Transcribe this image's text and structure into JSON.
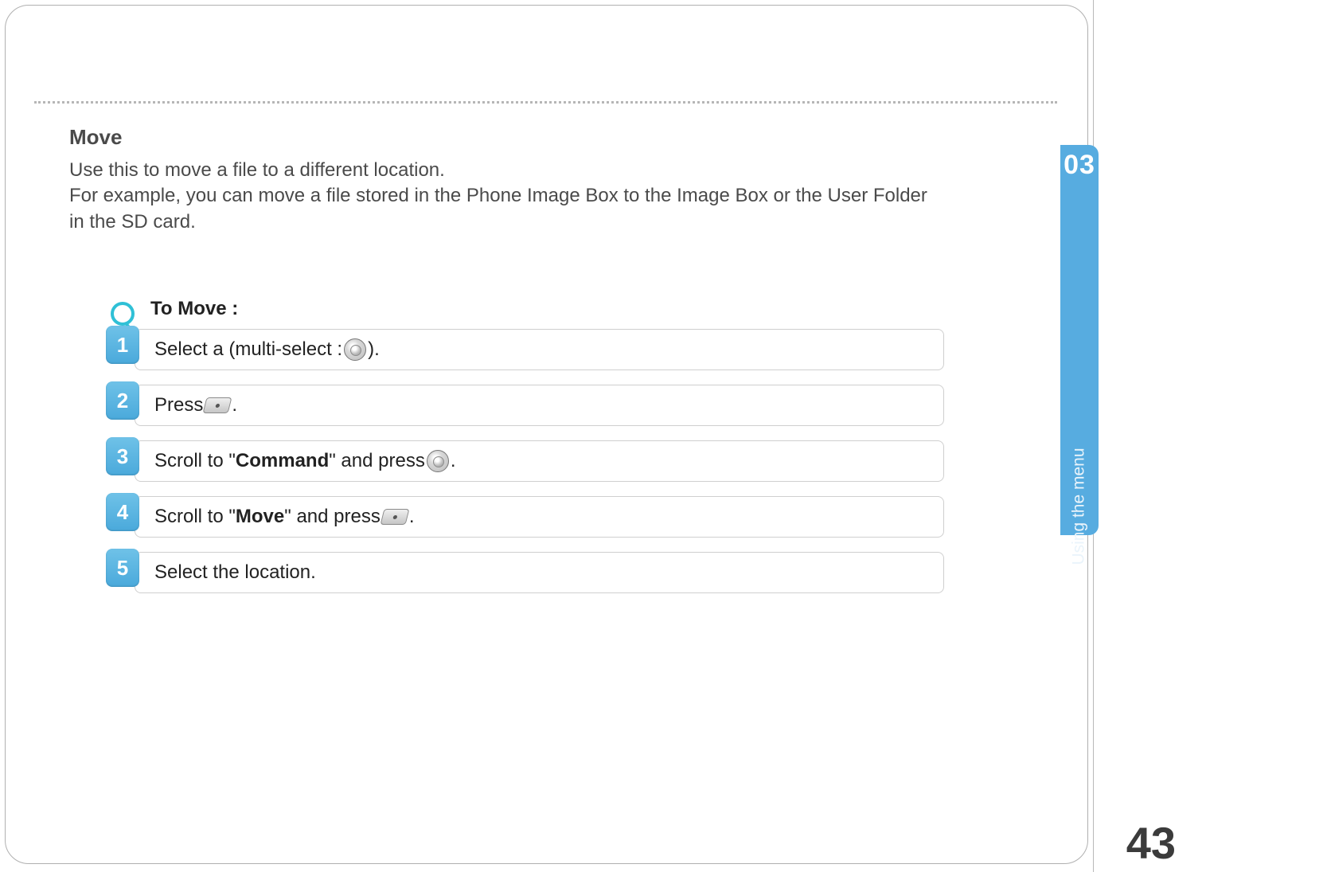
{
  "chapter": {
    "number": "03",
    "label": "Using the menu"
  },
  "page_number": "43",
  "section": {
    "title": "Move",
    "description_line1": "Use this to move a file to a different location.",
    "description_line2": "For example, you can move a file stored in the Phone Image Box to the Image Box or the User Folder in the SD card."
  },
  "steps_title": "To Move :",
  "steps": {
    "s1": {
      "num": "1",
      "pre": "Select a (multi-select : ",
      "post": ")."
    },
    "s2": {
      "num": "2",
      "pre": "Press ",
      "post": "."
    },
    "s3": {
      "num": "3",
      "pre": "Scroll to \"",
      "bold": "Command",
      "mid": "\" and press ",
      "post": "."
    },
    "s4": {
      "num": "4",
      "pre": "Scroll to \"",
      "bold": "Move",
      "mid": "\" and press ",
      "post": "."
    },
    "s5": {
      "num": "5",
      "text": "Select the location."
    }
  }
}
